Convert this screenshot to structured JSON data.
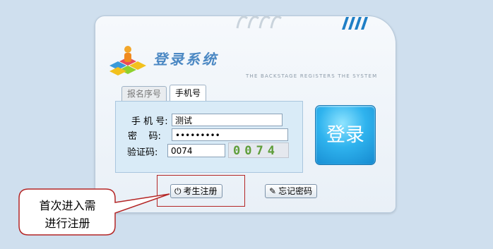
{
  "header": {
    "title": "登录系统",
    "subtitle": "THE BACKSTAGE REGISTERS THE SYSTEM"
  },
  "tabs": [
    {
      "label": "报名序号",
      "active": false
    },
    {
      "label": "手机号",
      "active": true
    }
  ],
  "form": {
    "phone_label": "手 机 号:",
    "phone_value": "测试",
    "password_label": "密    码:",
    "password_value": "•••••••••",
    "captcha_label": "验证码:",
    "captcha_value": "0074",
    "captcha_image_text": "0074"
  },
  "buttons": {
    "login": "登录",
    "register": "考生注册",
    "forgot": "忘记密码"
  },
  "callout": {
    "line1": "首次进入需",
    "line2": "进行注册"
  },
  "colors": {
    "background": "#cfdfee",
    "accent": "#2fb3ee",
    "title": "#4b88c3",
    "callout_border": "#b42626"
  }
}
